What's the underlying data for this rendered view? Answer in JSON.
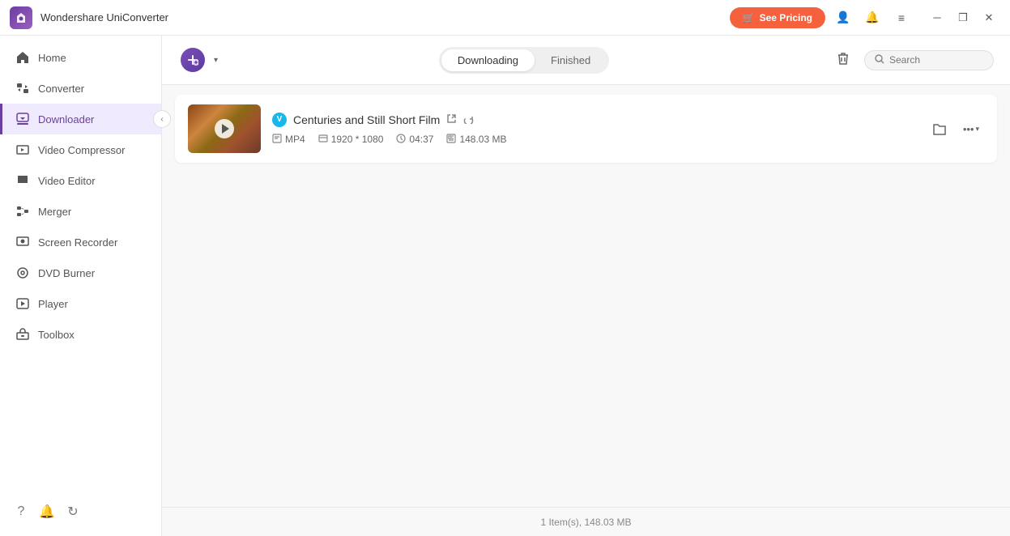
{
  "app": {
    "title": "Wondershare UniConverter",
    "logo_alt": "Wondershare logo"
  },
  "titlebar": {
    "see_pricing_label": "See Pricing",
    "menu_icon": "☰",
    "minimize_icon": "─",
    "maximize_icon": "❐",
    "close_icon": "✕"
  },
  "sidebar": {
    "items": [
      {
        "id": "home",
        "label": "Home",
        "active": false
      },
      {
        "id": "converter",
        "label": "Converter",
        "active": false
      },
      {
        "id": "downloader",
        "label": "Downloader",
        "active": true
      },
      {
        "id": "video-compressor",
        "label": "Video Compressor",
        "active": false
      },
      {
        "id": "video-editor",
        "label": "Video Editor",
        "active": false
      },
      {
        "id": "merger",
        "label": "Merger",
        "active": false
      },
      {
        "id": "screen-recorder",
        "label": "Screen Recorder",
        "active": false
      },
      {
        "id": "dvd-burner",
        "label": "DVD Burner",
        "active": false
      },
      {
        "id": "player",
        "label": "Player",
        "active": false
      },
      {
        "id": "toolbox",
        "label": "Toolbox",
        "active": false
      }
    ],
    "bottom_icons": [
      "?",
      "🔔",
      "↺"
    ]
  },
  "content_header": {
    "add_dropdown_label": "+",
    "tab_downloading": "Downloading",
    "tab_finished": "Finished",
    "active_tab": "downloading",
    "search_placeholder": "Search"
  },
  "video_item": {
    "source": "Vimeo",
    "source_badge": "V",
    "title": "Centuries and Still Short Film",
    "format": "MP4",
    "resolution": "1920 * 1080",
    "duration": "04:37",
    "file_size": "148.03 MB"
  },
  "status_bar": {
    "text": "1 Item(s), 148.03 MB"
  },
  "colors": {
    "accent": "#6b3fa0",
    "active_sidebar_bg": "#f0eaff",
    "pricing_btn": "#f5613c",
    "vimeo_blue": "#1ab7ea"
  }
}
